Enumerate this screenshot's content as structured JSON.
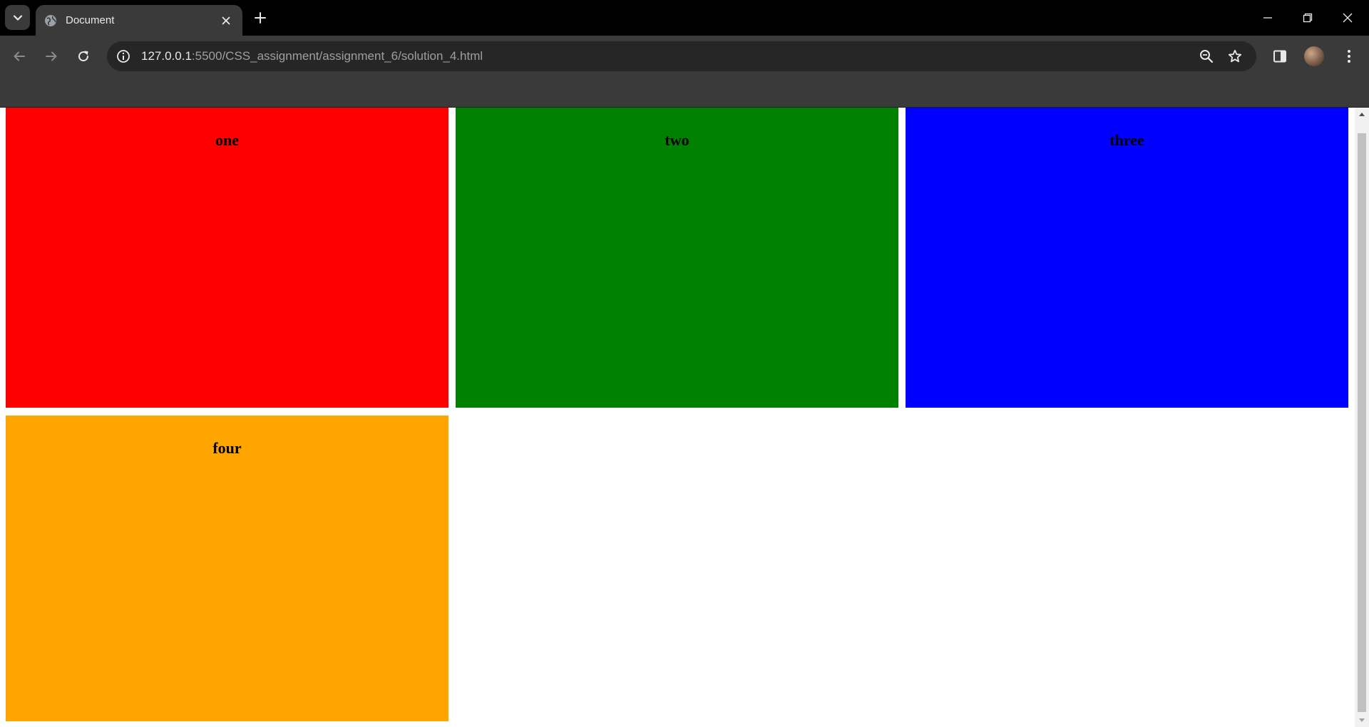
{
  "browser": {
    "tab": {
      "title": "Document"
    },
    "url": {
      "host": "127.0.0.1",
      "rest": ":5500/CSS_assignment/assignment_6/solution_4.html"
    },
    "icons": [
      "tab-search-icon",
      "globe-icon",
      "close-icon",
      "plus-icon",
      "minimize-icon",
      "restore-icon",
      "window-close-icon",
      "back-arrow-icon",
      "forward-arrow-icon",
      "reload-icon",
      "site-info-icon",
      "zoom-icon",
      "star-icon",
      "side-panel-icon",
      "avatar",
      "more-vert-icon"
    ]
  },
  "page": {
    "boxes": [
      {
        "label": "one",
        "color": "#ff0000"
      },
      {
        "label": "two",
        "color": "#008000"
      },
      {
        "label": "three",
        "color": "#0000ff"
      },
      {
        "label": "four",
        "color": "#ffa500"
      }
    ]
  }
}
